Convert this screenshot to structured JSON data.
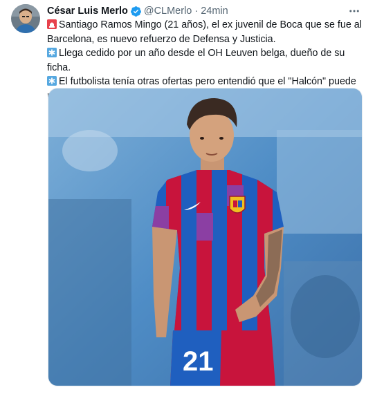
{
  "author": {
    "name": "César Luis Merlo",
    "handle": "@CLMerlo",
    "separator": "·",
    "time": "24min",
    "verified": true
  },
  "tweet": {
    "lines": [
      {
        "emoji": "siren-icon",
        "text": "Santiago Ramos Mingo (21 años), el ex juvenil de Boca que se fue al Barcelona, es nuevo refuerzo de Defensa y Justicia."
      },
      {
        "emoji": "asterisk-icon",
        "text": "Llega cedido por un año desde el OH Leuven belga, dueño de su ficha."
      },
      {
        "emoji": "asterisk-icon",
        "text": "El futbolista tenía otras ofertas pero entendió que el \"Halcón\" puede relanzarlo."
      }
    ]
  },
  "media": {
    "jersey_number": "21"
  },
  "colors": {
    "accent": "#1d9bf0",
    "text": "#0f1419",
    "secondary": "#536471"
  }
}
